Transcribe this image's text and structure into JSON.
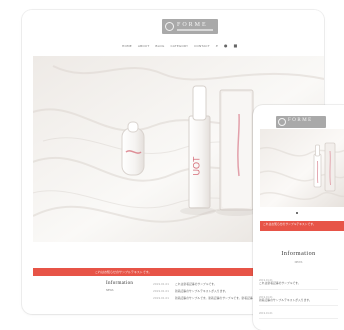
{
  "brand": {
    "logo_text": "FORME",
    "accent_color": "#e75447"
  },
  "desktop": {
    "nav_items": [
      "HOME",
      "ABOUT",
      "BLOG",
      "CATEGORY",
      "CONTACT"
    ],
    "nav_icons": [
      "search-icon",
      "user-icon",
      "cart-icon"
    ],
    "band_text": "これはお知らせのサンプルテキストです。",
    "info_title": "Information",
    "info_sub": "NEWS",
    "rows": [
      {
        "date": "2019.01.01",
        "text": "これは新着記事のサンプルです。"
      },
      {
        "date": "2019.01.01",
        "text": "新着記事のサンプルテキストが入ります。"
      },
      {
        "date": "2019.01.01",
        "text": "新着記事のサンプルです。新着記事のサンプルです。新着記事のサンプルです。"
      }
    ]
  },
  "phone": {
    "band_text": "これはお知らせのサンプルテキストです。",
    "info_title": "Information",
    "info_sub": "NEWS",
    "items": [
      {
        "date": "2019.01.01",
        "text": "これは新着記事のサンプルです。"
      },
      {
        "date": "2019.01.01",
        "text": "新着記事のサンプルテキストが入ります。"
      },
      {
        "date": "2019.01.01",
        "text": ""
      }
    ]
  }
}
